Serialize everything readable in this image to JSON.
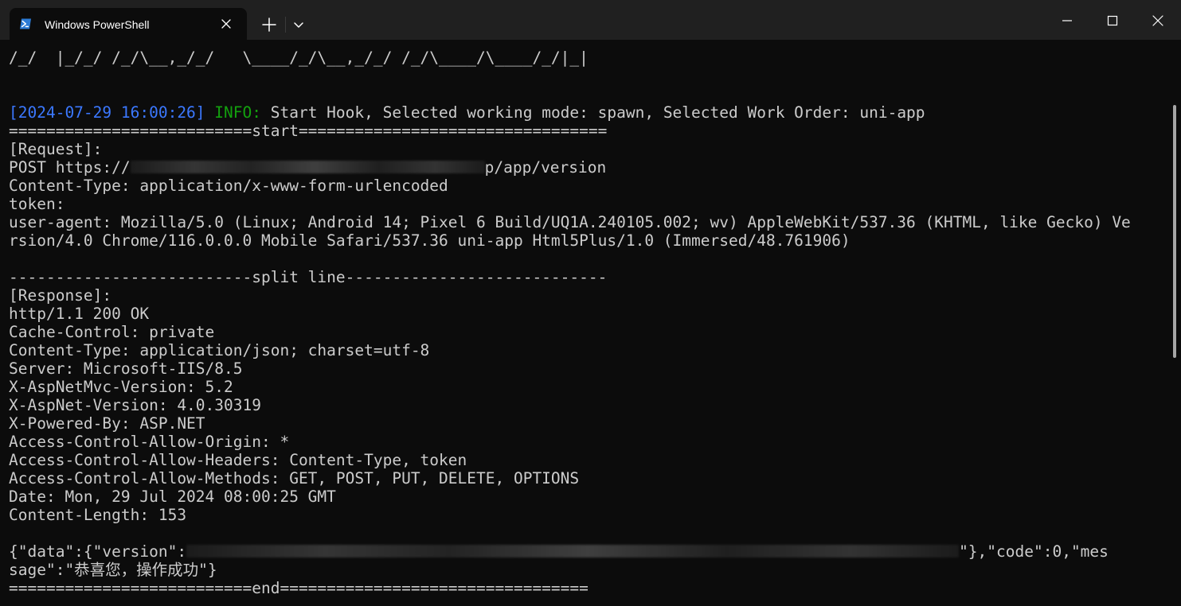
{
  "window": {
    "tab_title": "Windows PowerShell",
    "icons": {
      "tab_icon": "powershell-icon",
      "close": "close-icon",
      "new_tab": "plus-icon",
      "dropdown": "chevron-down-icon",
      "minimize": "minimize-icon",
      "maximize": "maximize-icon",
      "window_close": "close-icon"
    }
  },
  "colors": {
    "background": "#0c0c0c",
    "titlebar": "#202020",
    "text": "#cccccc",
    "timestamp": "#3b78ff",
    "info": "#13a10e"
  },
  "terminal": {
    "ascii_art_line": "/_/  |_/_/ /_/\\__,_/_/   \\____/_/\\__,_/_/ /_/\\____/\\____/_/|_|",
    "log": {
      "timestamp": "[2024-07-29 16:00:26]",
      "level": " INFO:",
      "message": " Start Hook, Selected working mode: spawn, Selected Work Order: uni-app"
    },
    "start_separator": "==========================start=================================",
    "request_header": "[Request]:",
    "request_line_prefix": "POST https://",
    "request_line_suffix": "p/app/version",
    "request_content_type": "Content-Type: application/x-www-form-urlencoded",
    "request_token": "token:",
    "user_agent_1": "user-agent: Mozilla/5.0 (Linux; Android 14; Pixel 6 Build/UQ1A.240105.002; wv) AppleWebKit/537.36 (KHTML, like Gecko) Ve",
    "user_agent_2": "rsion/4.0 Chrome/116.0.0.0 Mobile Safari/537.36 uni-app Html5Plus/1.0 (Immersed/48.761906)",
    "split_line": "--------------------------split line----------------------------",
    "response_header": "[Response]:",
    "response_lines": [
      "http/1.1 200 OK",
      "Cache-Control: private",
      "Content-Type: application/json; charset=utf-8",
      "Server: Microsoft-IIS/8.5",
      "X-AspNetMvc-Version: 5.2",
      "X-AspNet-Version: 4.0.30319",
      "X-Powered-By: ASP.NET",
      "Access-Control-Allow-Origin: *",
      "Access-Control-Allow-Headers: Content-Type, token",
      "Access-Control-Allow-Methods: GET, POST, PUT, DELETE, OPTIONS",
      "Date: Mon, 29 Jul 2024 08:00:25 GMT",
      "Content-Length: 153"
    ],
    "body_line_1_prefix": "{\"data\":{\"version\":",
    "body_line_1_suffix": "\"},\"code\":0,\"mes",
    "body_line_2": "sage\":\"恭喜您，操作成功\"}",
    "end_separator": "==========================end================================="
  }
}
